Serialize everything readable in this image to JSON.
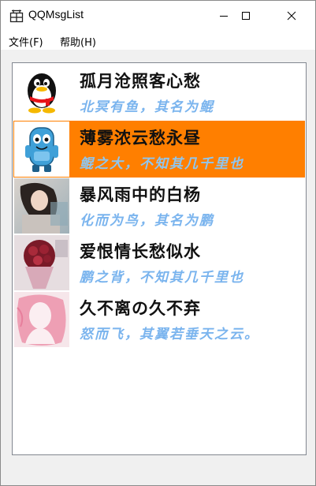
{
  "window": {
    "title": "QQMsgList",
    "icons": {
      "app": "app-grid-icon",
      "minimize": "minimize-icon",
      "maximize": "maximize-icon",
      "close": "close-icon"
    }
  },
  "menu": {
    "items": [
      {
        "label": "文件(F)"
      },
      {
        "label": "帮助(H)"
      }
    ]
  },
  "list": {
    "selected_color": "#ff7f00",
    "signature_color": "#7ab4ee",
    "items": [
      {
        "name": "孤月沧照客心愁",
        "signature": "北冥有鱼，其名为鲲",
        "avatar": "penguin-avatar"
      },
      {
        "name": "薄雾浓云愁永昼",
        "signature": "鲲之大，不知其几千里也",
        "avatar": "blue-character-avatar"
      },
      {
        "name": "暴风雨中的白杨",
        "signature": "化而为鸟，其名为鹏",
        "avatar": "girl-photo-avatar"
      },
      {
        "name": "爱恨情长愁似水",
        "signature": "鹏之背，不知其几千里也",
        "avatar": "flowers-photo-avatar"
      },
      {
        "name": "久不离の久不弃",
        "signature": "怒而飞，其翼若垂天之云。",
        "avatar": "pink-silhouette-avatar"
      }
    ]
  }
}
